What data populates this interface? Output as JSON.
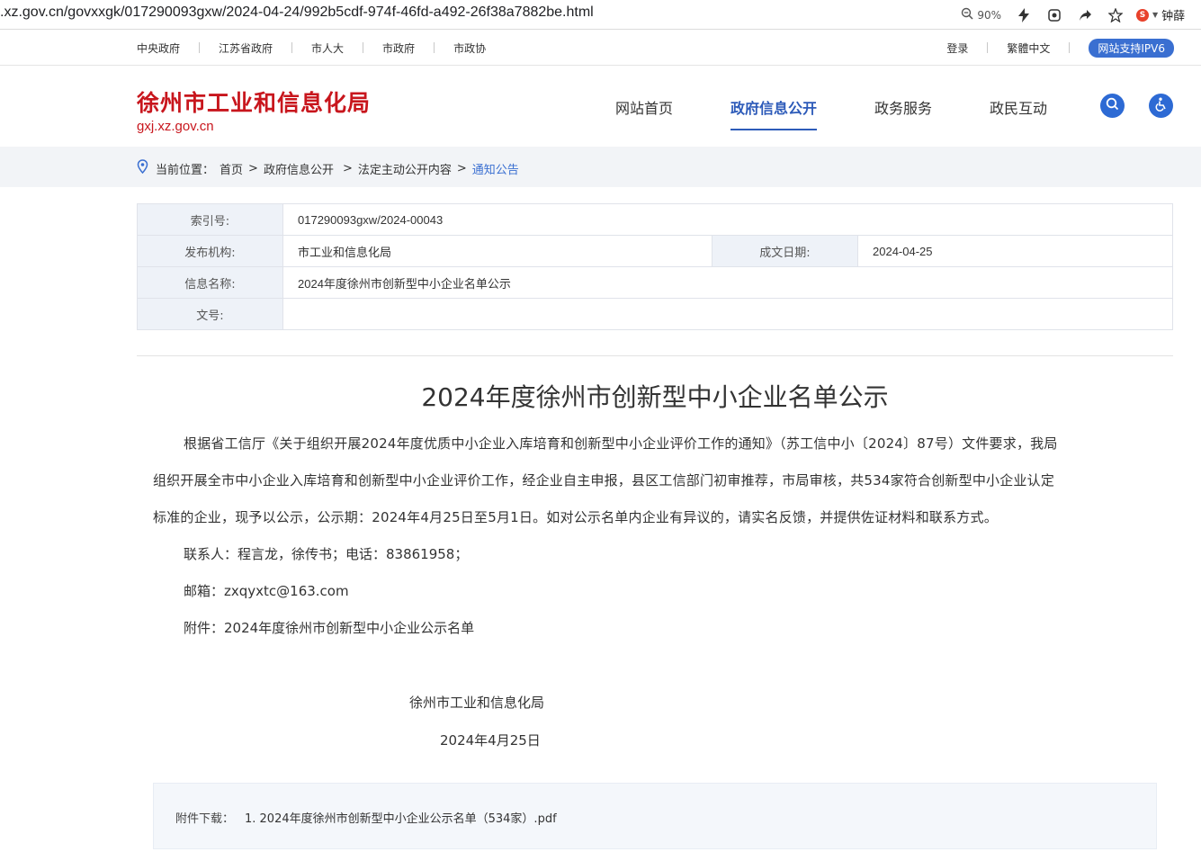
{
  "browser": {
    "url": ".xz.gov.cn/govxxgk/017290093gxw/2024-04-24/992b5cdf-974f-46fd-a492-26f38a7882be.html",
    "zoom": "90%",
    "user": "钟薛"
  },
  "top_links": {
    "left": [
      "中央政府",
      "江苏省政府",
      "市人大",
      "市政府",
      "市政协"
    ],
    "login": "登录",
    "traditional": "繁體中文",
    "ipv6": "网站支持IPV6"
  },
  "header": {
    "site_title": "徐州市工业和信息化局",
    "domain": "gxj.xz.gov.cn",
    "nav": [
      "网站首页",
      "政府信息公开",
      "政务服务",
      "政民互动"
    ],
    "active_nav": "政府信息公开"
  },
  "breadcrumb": {
    "label": "当前位置：",
    "items": [
      "首页",
      "政府信息公开",
      "法定主动公开内容",
      "通知公告"
    ]
  },
  "meta": {
    "index_label": "索引号:",
    "index_value": "017290093gxw/2024-00043",
    "org_label": "发布机构:",
    "org_value": "市工业和信息化局",
    "date_label": "成文日期:",
    "date_value": "2024-04-25",
    "name_label": "信息名称:",
    "name_value": "2024年度徐州市创新型中小企业名单公示",
    "docno_label": "文号:",
    "docno_value": ""
  },
  "article": {
    "title": "2024年度徐州市创新型中小企业名单公示",
    "para1_l1": "根据省工信厅《关于组织开展2024年度优质中小企业入库培育和创新型中小企业评价工作的通知》（苏工信中小〔2024〕87号）文件要求，我局",
    "para1_l2": "组织开展全市中小企业入库培育和创新型中小企业评价工作，经企业自主申报，县区工信部门初审推荐，市局审核，共534家符合创新型中小企业认定",
    "para1_l3": "标准的企业，现予以公示，公示期：2024年4月25日至5月1日。如对公示名单内企业有异议的，请实名反馈，并提供佐证材料和联系方式。",
    "contact": "联系人：程言龙，徐传书；电话：83861958；",
    "email": "邮箱：zxqyxtc@163.com",
    "attachment_line": "附件：2024年度徐州市创新型中小企业公示名单",
    "signature": "徐州市工业和信息化局",
    "sign_date": "2024年4月25日"
  },
  "download": {
    "label": "附件下载：",
    "file": "1. 2024年度徐州市创新型中小企业公示名单（534家）.pdf"
  },
  "icons": [
    "zoom-icon",
    "lightning-icon",
    "shield-icon",
    "share-icon",
    "star-icon",
    "search-icon",
    "accessibility-icon",
    "location-icon"
  ],
  "colors": {
    "brand_red": "#c8161d",
    "accent_blue": "#2d5bb9",
    "link_blue": "#3a6fd1"
  }
}
